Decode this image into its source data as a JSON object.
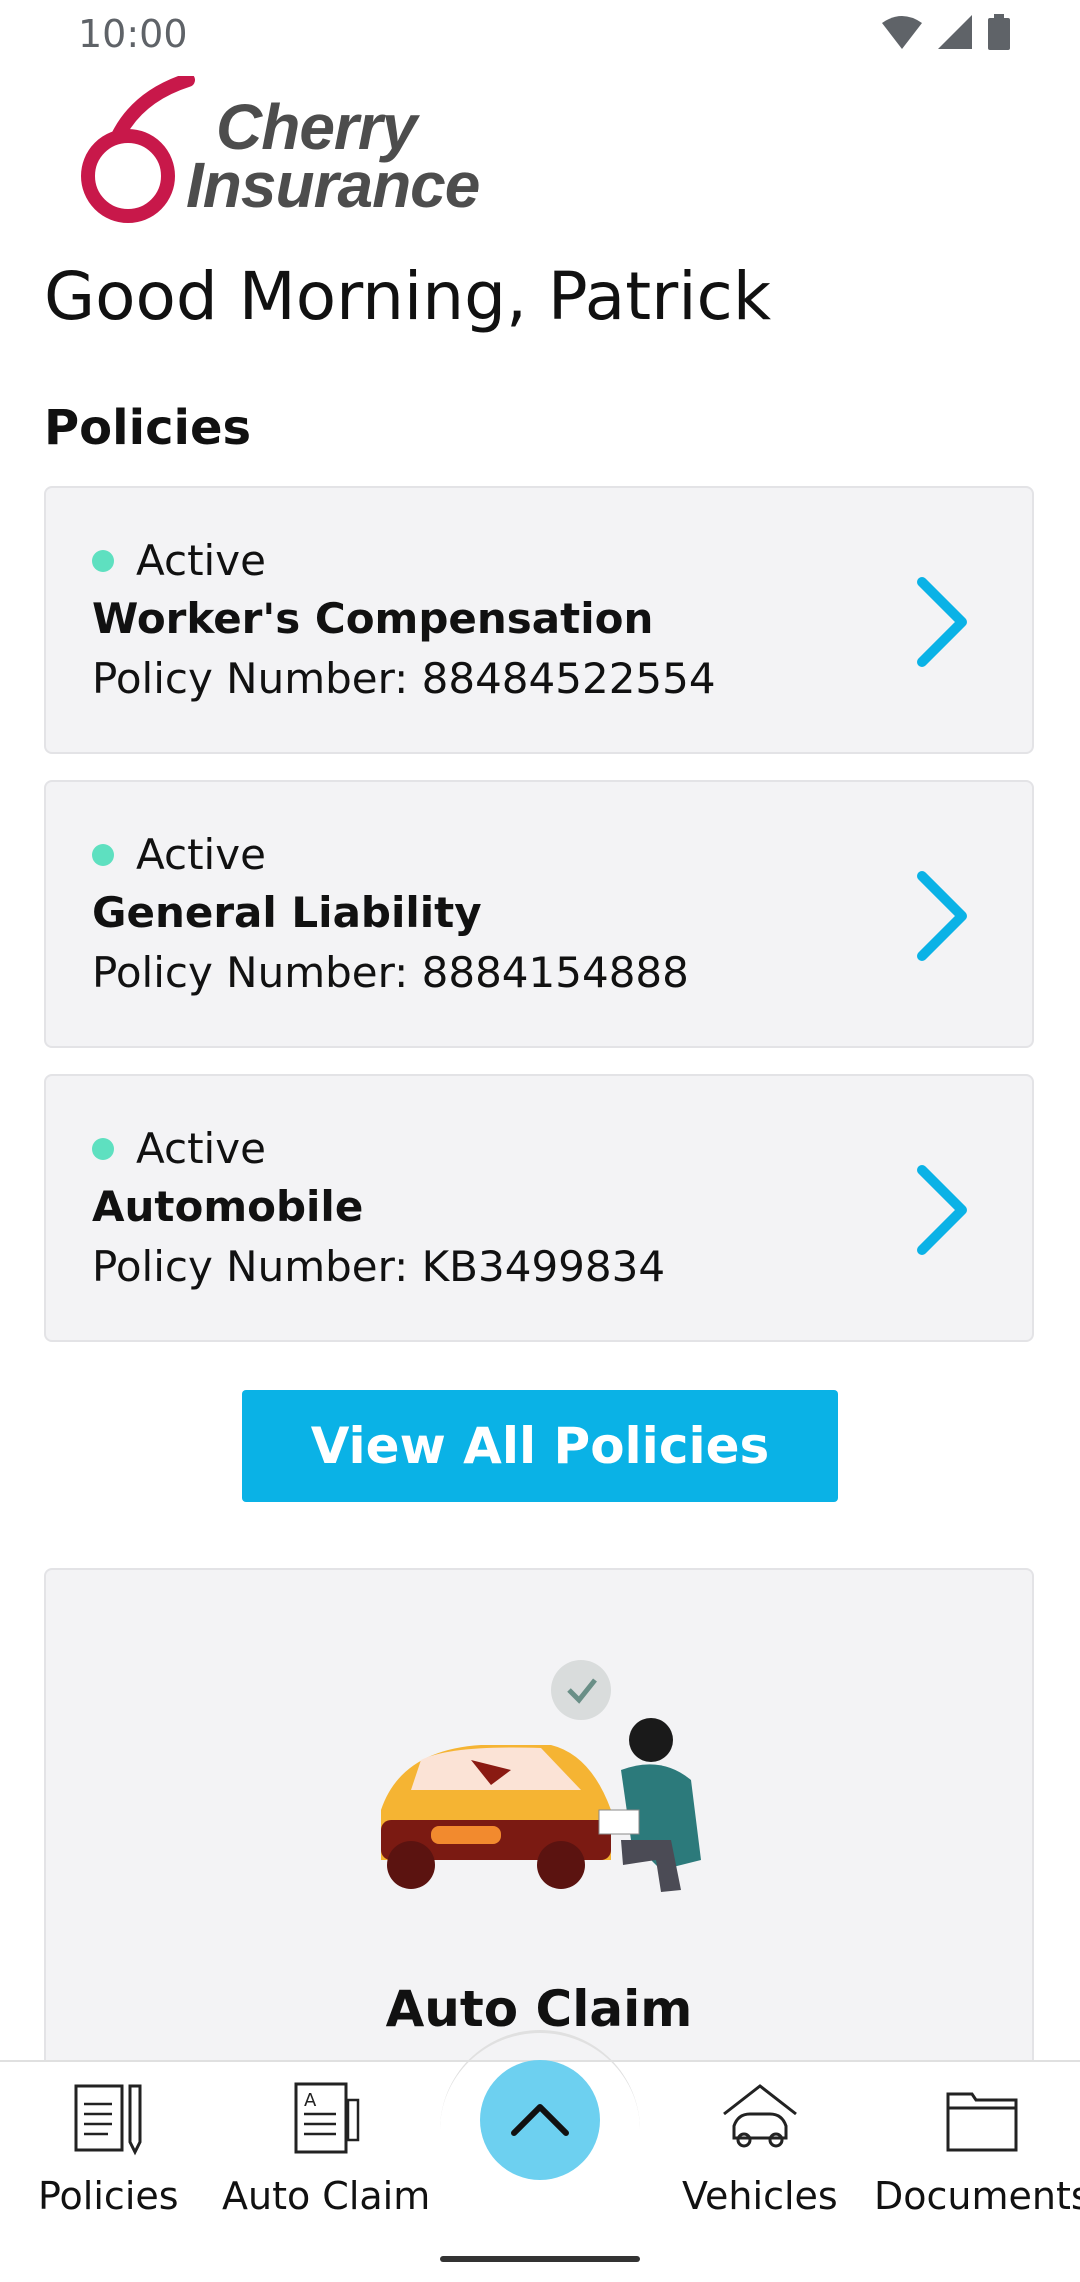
{
  "status_bar": {
    "time": "10:00"
  },
  "logo": {
    "line1": "Cherry",
    "line2": "Insurance"
  },
  "greeting": "Good Morning, Patrick",
  "policies_section": {
    "title": "Policies",
    "items": [
      {
        "status": "Active",
        "name": "Worker's Compensation",
        "number": "Policy Number: 88484522554"
      },
      {
        "status": "Active",
        "name": "General Liability",
        "number": "Policy Number: 8884154888"
      },
      {
        "status": "Active",
        "name": "Automobile",
        "number": "Policy Number: KB3499834"
      }
    ],
    "view_all_label": "View All Policies"
  },
  "claim_card": {
    "title": "Auto Claim"
  },
  "bottom_nav": {
    "items": [
      {
        "label": "Policies",
        "icon": "policies-icon"
      },
      {
        "label": "Auto Claim",
        "icon": "auto-claim-icon"
      },
      {
        "label": "Vehicles",
        "icon": "vehicles-icon"
      },
      {
        "label": "Documents",
        "icon": "documents-icon"
      }
    ],
    "fab_icon": "chevron-up-icon"
  },
  "colors": {
    "accent": "#0ab2e6",
    "fab": "#6dd0f0",
    "active_dot": "#5ee0c0",
    "brand": "#c8184a",
    "card_bg": "#f3f3f5"
  }
}
